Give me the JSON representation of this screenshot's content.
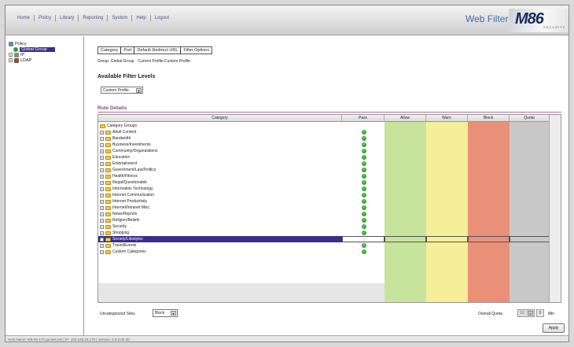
{
  "nav": [
    "Home",
    "Policy",
    "Library",
    "Reporting",
    "System",
    "Help",
    "Logout"
  ],
  "brand": {
    "title": "Web Filter",
    "logo": "M86",
    "logo_sub": "SECURITY"
  },
  "tree": {
    "root": "Policy",
    "selected": "Global Group",
    "ip": "IP",
    "ldap": "LDAP"
  },
  "tabs": [
    "Category",
    "Port",
    "Default Redirect URL",
    "Filter Options"
  ],
  "crumbs": [
    "Group: Global Group",
    "Current Profile:Custom Profile"
  ],
  "available_filter_levels": "Available Filter Levels",
  "profile_select": "Custom Profile",
  "rule_details": "Rule Details",
  "columns": {
    "category": "Category",
    "pass": "Pass",
    "allow": "Allow",
    "warn": "Warn",
    "block": "Block",
    "quota": "Quota"
  },
  "column_colors": {
    "allow": "#c8e39b",
    "warn": "#f5ef9a",
    "block": "#ea9078",
    "quota": "#c8c8c8"
  },
  "category_groups_label": "Category Groups",
  "categories": [
    "Adult Content",
    "Bandwidth",
    "Business/Investments",
    "Community/Organizations",
    "Education",
    "Entertainment",
    "Government/Law/Politics",
    "Health/Fitness",
    "Illegal/Questionable",
    "Information Technology",
    "Internet Communication",
    "Internet Productivity",
    "Internet/Intranet Misc.",
    "News/Reports",
    "Religion/Beliefs",
    "Security",
    "Shopping",
    "Society/Lifestyles",
    "Travel/Events",
    "Custom Categories"
  ],
  "selected_category": "Society/Lifestyles",
  "uncategorized": {
    "label": "Uncategorized Sites",
    "value": "Block"
  },
  "overall_quota": {
    "label": "Overall Quota",
    "value": "10",
    "num": "0",
    "unit": "Min"
  },
  "apply_label": "Apply",
  "status_bar": "Host Name: 8/9-03-170.qa.8e6.net  |  IP: 192.168.20.170  |  Version: 4.9.0.00.00"
}
